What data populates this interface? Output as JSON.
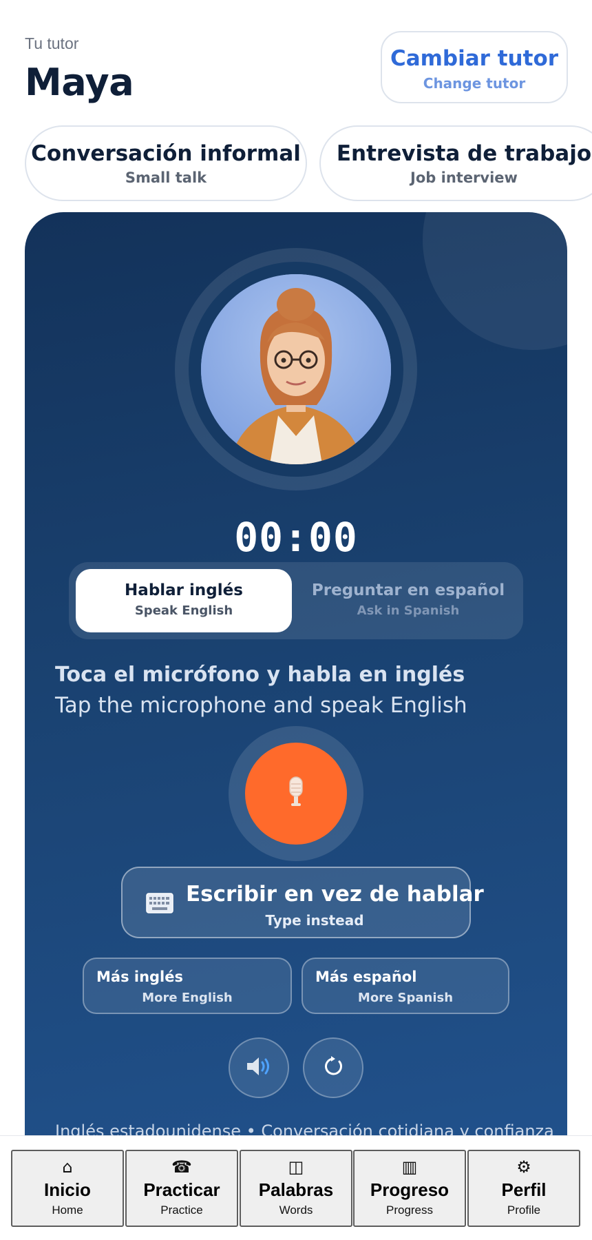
{
  "header": {
    "caption": "Tu tutor",
    "tutor_name": "Maya",
    "change_button": {
      "label_es": "Cambiar tutor",
      "label_en": "Change tutor"
    }
  },
  "scenarios": [
    {
      "label_es": "Conversación informal",
      "label_en": "Small talk"
    },
    {
      "label_es": "Entrevista de trabajo",
      "label_en": "Job interview"
    }
  ],
  "session": {
    "timer": "00:00",
    "modes": [
      {
        "label_es": "Hablar inglés",
        "label_en": "Speak English",
        "selected": true
      },
      {
        "label_es": "Preguntar en español",
        "label_en": "Ask in Spanish",
        "selected": false
      }
    ],
    "hint_es": "Toca el micrófono y habla en inglés",
    "hint_en": "Tap the microphone and speak English",
    "type_button": {
      "label_es": "Escribir en vez de hablar",
      "label_en": "Type instead"
    },
    "more_english": {
      "label_es": "Más inglés",
      "label_en": "More English"
    },
    "more_spanish": {
      "label_es": "Más español",
      "label_en": "More Spanish"
    },
    "footer": "Inglés estadounidense • Conversación cotidiana y confianza"
  },
  "nav": [
    {
      "icon": "⌂",
      "label_es": "Inicio",
      "label_en": "Home"
    },
    {
      "icon": "☎",
      "label_es": "Practicar",
      "label_en": "Practice"
    },
    {
      "icon": "◫",
      "label_es": "Palabras",
      "label_en": "Words"
    },
    {
      "icon": "▥",
      "label_es": "Progreso",
      "label_en": "Progress"
    },
    {
      "icon": "⚙",
      "label_es": "Perfil",
      "label_en": "Profile"
    }
  ],
  "colors": {
    "accent": "#2f6ad8",
    "mic": "#ff6a2b",
    "card_top": "#13325a",
    "card_bottom": "#21528d"
  }
}
